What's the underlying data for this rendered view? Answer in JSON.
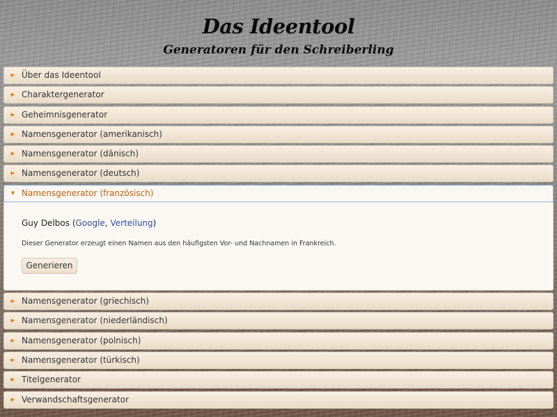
{
  "header": {
    "title": "Das Ideentool",
    "subtitle": "Generatoren für den Schreiberling"
  },
  "accordion": {
    "items_before": [
      {
        "label": "Über das Ideentool"
      },
      {
        "label": "Charaktergenerator"
      },
      {
        "label": "Geheimnisgenerator"
      },
      {
        "label": "Namensgenerator (amerikanisch)"
      },
      {
        "label": "Namensgenerator (dänisch)"
      },
      {
        "label": "Namensgenerator (deutsch)"
      }
    ],
    "active": {
      "label": "Namensgenerator (französisch)",
      "result_name": "Guy Delbos",
      "paren_open": " (",
      "link_google": "Google",
      "separator": ", ",
      "link_distribution": "Verteilung",
      "paren_close": ")",
      "description": "Dieser Generator erzeugt einen Namen aus den häufigsten Vor- und Nachnamen in Frankreich.",
      "button_label": "Generieren"
    },
    "items_after": [
      {
        "label": "Namensgenerator (griechisch)"
      },
      {
        "label": "Namensgenerator (niederländisch)"
      },
      {
        "label": "Namensgenerator (polnisch)"
      },
      {
        "label": "Namensgenerator (türkisch)"
      },
      {
        "label": "Titelgenerator"
      },
      {
        "label": "Verwandschaftsgenerator"
      }
    ]
  },
  "icons": {
    "collapsed": "triangle-right-icon",
    "expanded": "triangle-down-icon"
  },
  "colors": {
    "accent": "#e07a10",
    "active_label": "#c0620c",
    "link": "#2a4fa3"
  }
}
